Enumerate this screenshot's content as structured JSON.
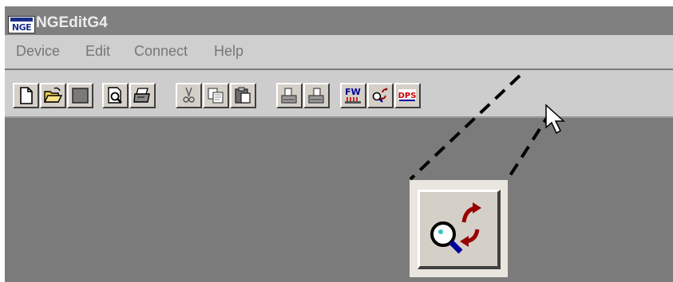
{
  "window": {
    "title": "NGEditG4",
    "logo_text": "NGE"
  },
  "menu": {
    "items": [
      "Device",
      "Edit",
      "Connect",
      "Help"
    ]
  },
  "toolbar": {
    "buttons": [
      {
        "icon": "new-document-icon"
      },
      {
        "icon": "open-folder-icon"
      },
      {
        "icon": "save-disk-icon"
      },
      {
        "icon": "print-preview-icon"
      },
      {
        "icon": "print-icon"
      },
      {
        "icon": "cut-icon"
      },
      {
        "icon": "copy-icon"
      },
      {
        "icon": "paste-icon"
      },
      {
        "icon": "upload-icon"
      },
      {
        "icon": "download-icon"
      },
      {
        "icon": "firmware-update-icon",
        "text": "FW"
      },
      {
        "icon": "search-refresh-icon"
      },
      {
        "icon": "dps-icon",
        "text": "DPS"
      }
    ]
  },
  "callout": {
    "icon": "search-refresh-icon"
  },
  "colors": {
    "title_text": "#ececec",
    "client_area": "#7b7b7b",
    "button_face": "#d4d0c8",
    "accent_red": "#cc0000",
    "accent_blue": "#000099"
  }
}
